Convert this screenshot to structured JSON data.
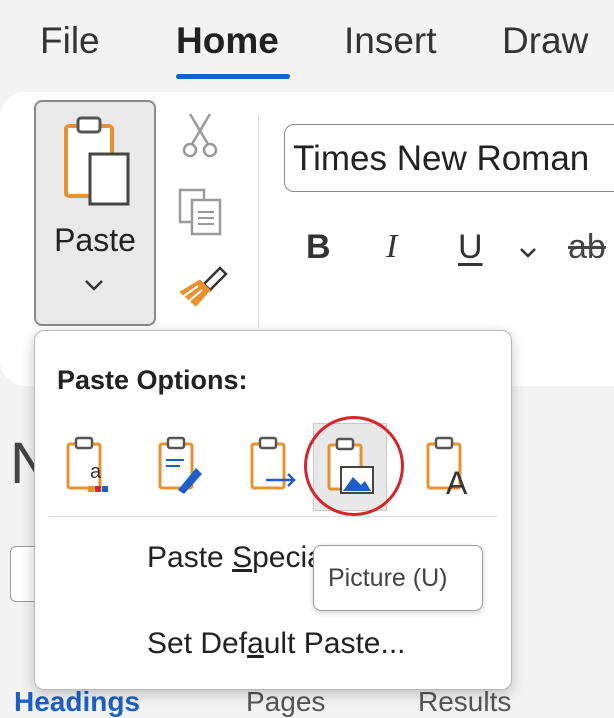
{
  "tabs": [
    {
      "label": "File"
    },
    {
      "label": "Home"
    },
    {
      "label": "Insert"
    },
    {
      "label": "Draw"
    }
  ],
  "active_tab": "Home",
  "clipboard": {
    "paste_label": "Paste",
    "icons": [
      "paste-icon",
      "cut-icon",
      "copy-icon",
      "format-painter-icon"
    ]
  },
  "font": {
    "name": "Times New Roman",
    "bold": "B",
    "italic": "I",
    "underline": "U",
    "strikethrough": "ab"
  },
  "paste_menu": {
    "header": "Paste Options:",
    "options": [
      {
        "icon": "keep-source-formatting-icon"
      },
      {
        "icon": "merge-formatting-icon"
      },
      {
        "icon": "use-destination-styles-icon"
      },
      {
        "icon": "picture-icon",
        "selected": true
      },
      {
        "icon": "keep-text-only-icon"
      }
    ],
    "items": [
      {
        "pre": "Paste ",
        "key": "S",
        "post": "pecial..."
      },
      {
        "pre": "Set Def",
        "key": "a",
        "post": "ult Paste..."
      }
    ]
  },
  "tooltip": {
    "text": "Picture (U)"
  },
  "background": {
    "title_fragment": "N",
    "nav_tabs": [
      "Headings",
      "Pages",
      "Results"
    ]
  },
  "colors": {
    "accent": "#1d5ec8",
    "clipboard_orange": "#e8922f",
    "highlight_circle": "#d5272b"
  }
}
